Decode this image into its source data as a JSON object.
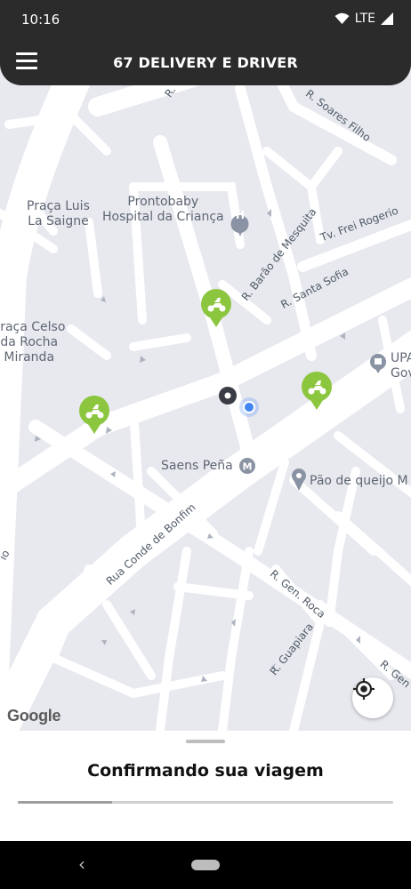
{
  "status_bar": {
    "time": "10:16",
    "network": "LTE"
  },
  "app_bar": {
    "title": "67 DELIVERY E DRIVER"
  },
  "map": {
    "labels": {
      "praca_luis": "Praça Luis\nLa Saigne",
      "prontobaby": "Prontobaby\nHospital da Criança",
      "praca_celso": "Praça Celso\nda Rocha\nMiranda",
      "saens_pena": "Saens Peña",
      "pao_de_queijo": "Pão de queijo M",
      "upa": "UPA\nGov",
      "soares_filho": "R. Soares Filho",
      "frei_rogerio": "Tv. Frei Rogerio",
      "barao_mesquita": "R. Barão de Mesquita",
      "santa_sofia": "R. Santa Sofia",
      "conde_bonfim": "Rua Conde de Bonfim",
      "gen_roca": "R. Gen. Roca",
      "guapiara": "R. Guapiara",
      "gen_edge": "R. Gen",
      "r_edge": "R.",
      "io_edge": "io"
    },
    "attribution": "Google"
  },
  "bottom_sheet": {
    "title": "Confirmando sua viagem",
    "progress": 0.25
  },
  "colors": {
    "app_bar": "#2b2b2b",
    "driver_pin": "#8cc63f",
    "map_bg": "#e7e9ef",
    "user_location": "#4285f4"
  }
}
